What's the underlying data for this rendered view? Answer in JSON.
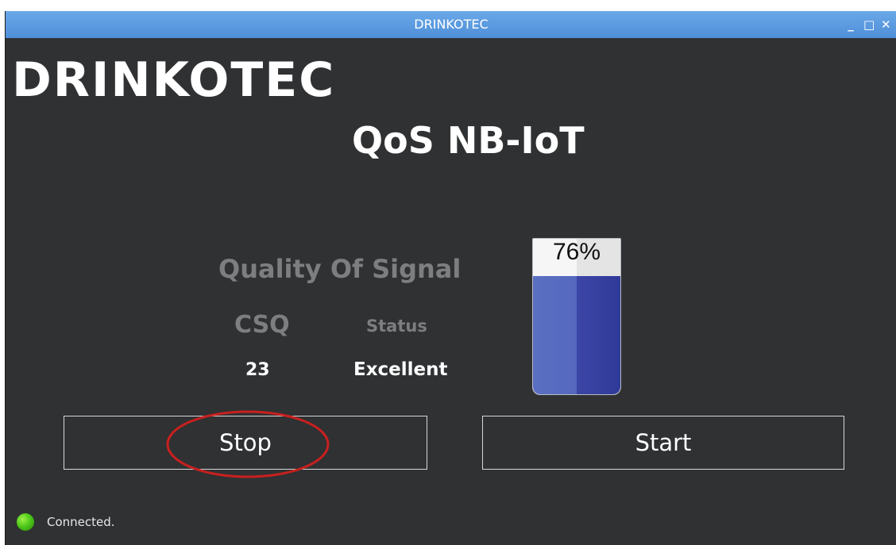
{
  "window": {
    "title": "DRINKOTEC",
    "controls": {
      "minimize": "_",
      "maximize": "□",
      "close": "✕"
    }
  },
  "header": {
    "brand": "DRINKOTEC",
    "subtitle": "QoS NB-IoT"
  },
  "signal": {
    "heading": "Quality Of Signal",
    "csq_label": "CSQ",
    "status_label": "Status",
    "csq_value": "23",
    "status_value": "Excellent",
    "meter_label": "76%",
    "meter_fraction": 0.76,
    "meter_fill_color": "#3d46a6"
  },
  "buttons": {
    "stop_label": "Stop",
    "start_label": "Start"
  },
  "statusbar": {
    "text": "Connected.",
    "indicator_color": "#4fc81a"
  },
  "annotation": {
    "color": "#c8201e"
  }
}
